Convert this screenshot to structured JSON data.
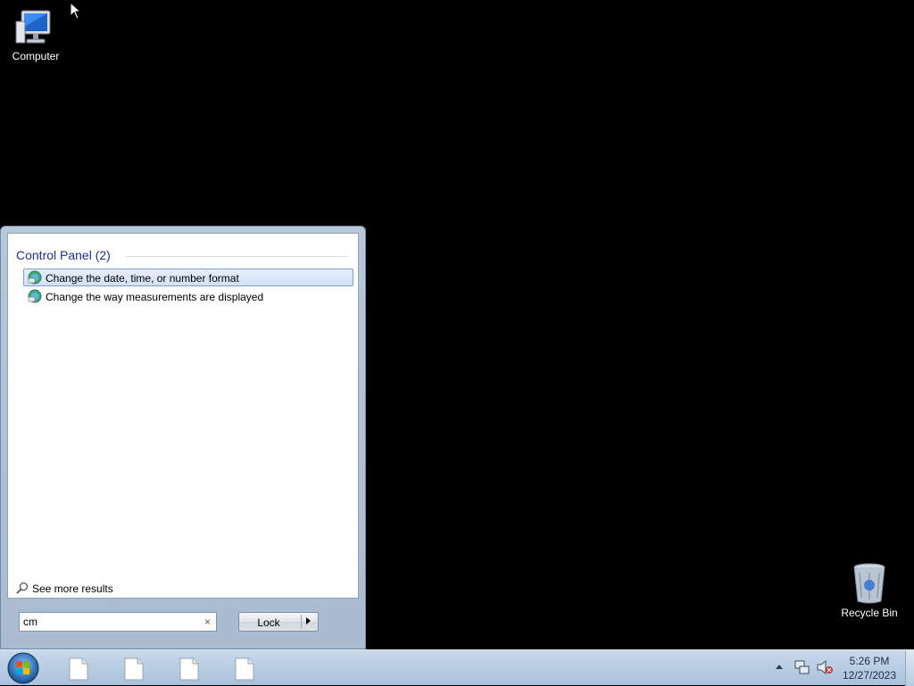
{
  "desktop": {
    "icons": [
      {
        "label": "Computer",
        "icon": "computer-icon"
      },
      {
        "label": "Recycle Bin",
        "icon": "recycle-bin-icon"
      }
    ]
  },
  "start_menu": {
    "group": {
      "title": "Control Panel (2)"
    },
    "results": [
      {
        "label": "Change the date, time, or number format",
        "icon": "control-panel-icon",
        "selected": true
      },
      {
        "label": "Change the way measurements are displayed",
        "icon": "control-panel-icon",
        "selected": false
      }
    ],
    "see_more": "See more results",
    "search": {
      "value": "cm",
      "clear": "×"
    },
    "power_button": {
      "label": "Lock"
    }
  },
  "taskbar": {
    "pinned": [
      "document-icon",
      "document-icon",
      "document-icon",
      "document-icon"
    ],
    "tray_icons": [
      "show-hidden-icons-arrow",
      "network-icon",
      "volume-muted-icon"
    ],
    "clock": {
      "time": "5:26 PM",
      "date": "12/27/2023"
    }
  },
  "colors": {
    "accent": "#1e3287",
    "selection": "#d2e1f5",
    "taskbar": "#b9cde2"
  }
}
